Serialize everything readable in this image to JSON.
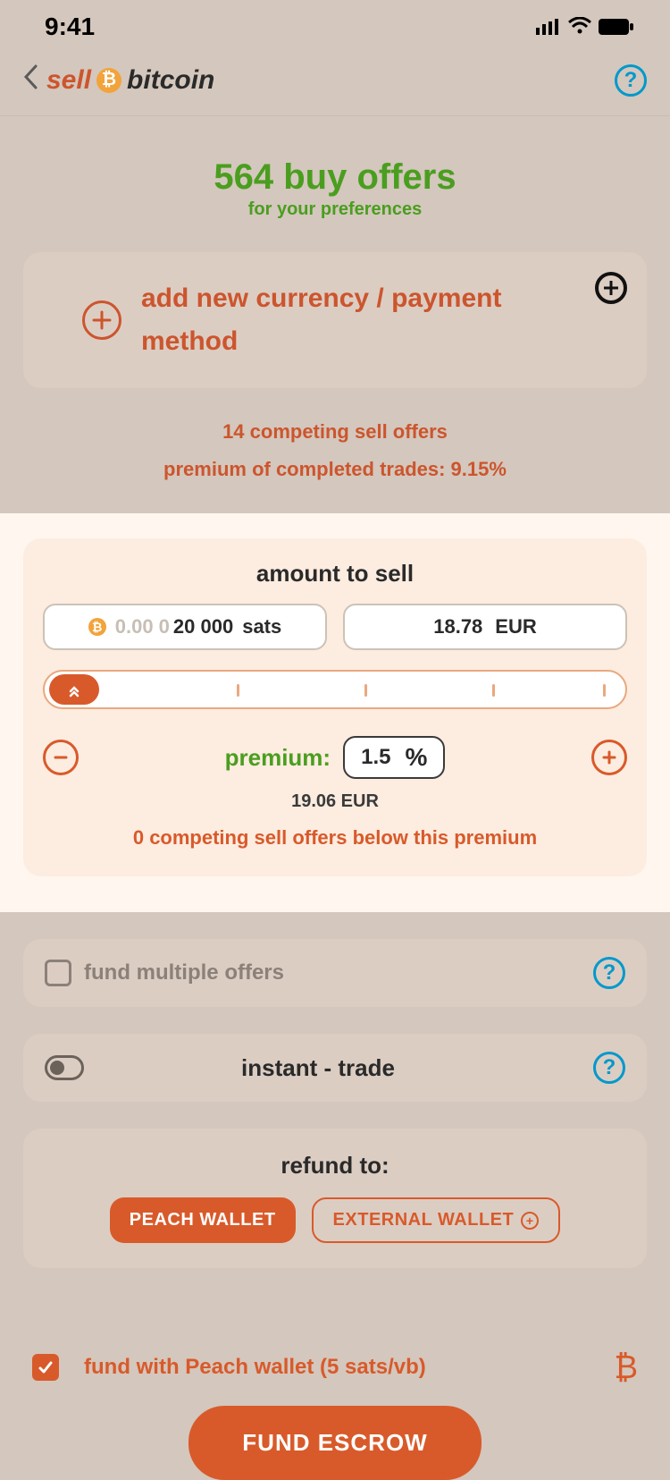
{
  "status": {
    "time": "9:41"
  },
  "header": {
    "sell": "sell",
    "bitcoin": "bitcoin"
  },
  "offers": {
    "title": "564 buy offers",
    "subtitle": "for your preferences"
  },
  "addPayment": {
    "text": "add new currency / payment method"
  },
  "competing": {
    "line1": "14 competing sell offers",
    "line2": "premium of completed trades: 9.15%"
  },
  "amount": {
    "title": "amount to sell",
    "satsPrefix": "0.00 0",
    "satsValue": "20 000",
    "satsUnit": "sats",
    "fiatValue": "18.78",
    "fiatUnit": "EUR"
  },
  "premium": {
    "label": "premium:",
    "value": "1.5",
    "symbol": "%",
    "result": "19.06 EUR",
    "competing": "0 competing sell offers below this premium"
  },
  "fundMultiple": {
    "label": "fund multiple offers"
  },
  "instant": {
    "label": "instant - trade"
  },
  "refund": {
    "title": "refund to:",
    "peach": "PEACH WALLET",
    "external": "EXTERNAL WALLET"
  },
  "fundWith": {
    "label": "fund with Peach wallet (5 sats/vb)"
  },
  "cta": {
    "label": "FUND ESCROW"
  }
}
